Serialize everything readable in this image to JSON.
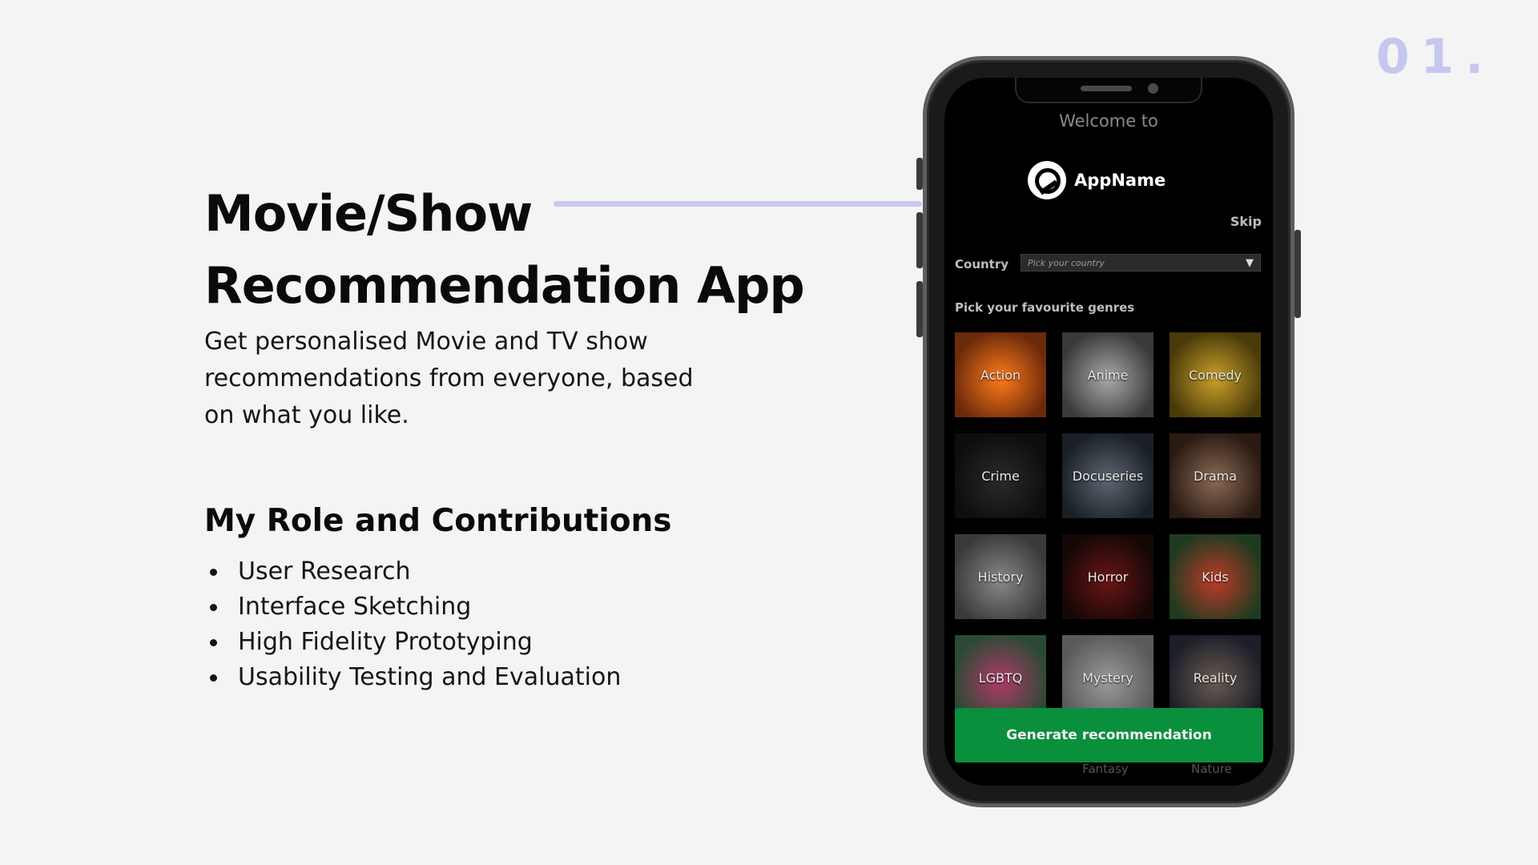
{
  "slide": {
    "number": "01."
  },
  "hero": {
    "title_line1": "Movie/Show",
    "title_line2": "Recommendation App",
    "subtitle": "Get personalised Movie and TV show recommendations from everyone, based on what you like."
  },
  "role": {
    "heading": "My Role and Contributions",
    "items": [
      "User Research",
      "Interface Sketching",
      "High Fidelity Prototyping",
      "Usability Testing and Evaluation"
    ]
  },
  "app": {
    "welcome": "Welcome to",
    "name": "AppName",
    "skip": "Skip",
    "country_label": "Country",
    "country_placeholder": "Pick your country",
    "genres_label": "Pick your favourite genres",
    "genres": [
      {
        "label": "Action",
        "color_a": "#6b2a0b",
        "color_b": "#ff7a1a"
      },
      {
        "label": "Anime",
        "color_a": "#3a3a3a",
        "color_b": "#a9a9a9"
      },
      {
        "label": "Comedy",
        "color_a": "#4a3a0a",
        "color_b": "#c9a12a"
      },
      {
        "label": "Crime",
        "color_a": "#0d0d0d",
        "color_b": "#2a2a2a"
      },
      {
        "label": "Docuseries",
        "color_a": "#1a1f26",
        "color_b": "#5d6670"
      },
      {
        "label": "Drama",
        "color_a": "#2a1a12",
        "color_b": "#8a6a55"
      },
      {
        "label": "History",
        "color_a": "#3a3a3a",
        "color_b": "#888888"
      },
      {
        "label": "Horror",
        "color_a": "#160707",
        "color_b": "#6a1515"
      },
      {
        "label": "Kids",
        "color_a": "#1f3b1f",
        "color_b": "#c03a2a"
      },
      {
        "label": "LGBTQ",
        "color_a": "#2a4a33",
        "color_b": "#b03a6a"
      },
      {
        "label": "Mystery",
        "color_a": "#5a5a5a",
        "color_b": "#9a9a9a"
      },
      {
        "label": "Reality",
        "color_a": "#1c1f29",
        "color_b": "#6a5a50"
      }
    ],
    "cta": "Generate recommendation",
    "under_cta": [
      "Fantasy",
      "Nature"
    ]
  },
  "colors": {
    "accent": "#c9c9f2",
    "cta_green": "#0a8f3d",
    "background": "#f4f4f4"
  }
}
